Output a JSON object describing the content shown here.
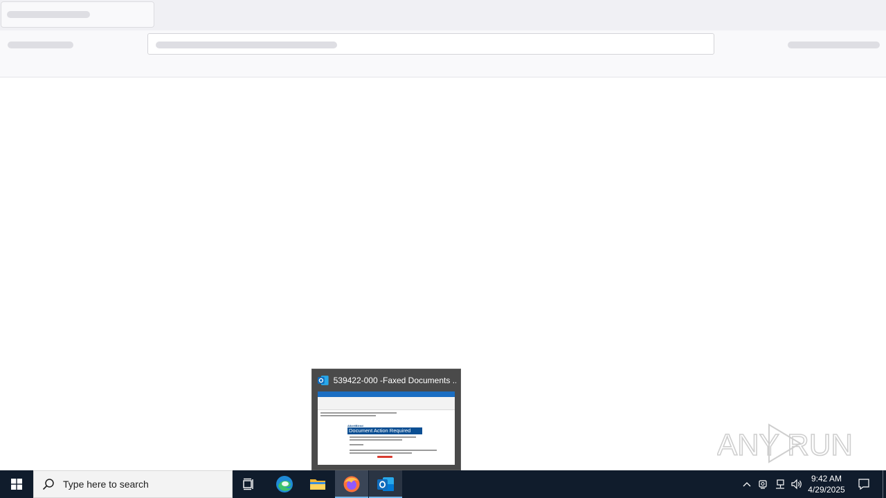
{
  "taskbar": {
    "search_placeholder": "Type here to search",
    "clock": {
      "time": "9:42 AM",
      "date": "4/29/2025"
    },
    "apps": [
      {
        "name": "Task View",
        "icon": "task-view-icon"
      },
      {
        "name": "Microsoft Edge",
        "icon": "edge-icon"
      },
      {
        "name": "File Explorer",
        "icon": "folder-icon"
      },
      {
        "name": "Firefox",
        "icon": "firefox-icon",
        "active": true
      },
      {
        "name": "Outlook",
        "icon": "outlook-icon",
        "active": true
      }
    ]
  },
  "preview": {
    "title": "539422-000 -Faxed Documents ...",
    "thumb_heading": "AlbertBlend",
    "thumb_banner": "Document Action Required"
  },
  "watermark": {
    "text": "ANY RUN"
  },
  "colors": {
    "taskbar": "#101c2c",
    "accent": "#76b9ed",
    "outlook_blue": "#0f6cbd",
    "banner_blue": "#0b4f93"
  }
}
